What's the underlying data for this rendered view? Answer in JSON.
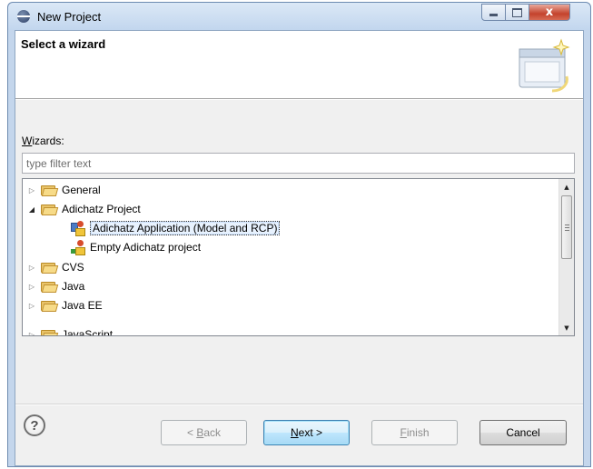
{
  "window": {
    "title": "New Project",
    "controls": {
      "minimize": "",
      "maximize": "",
      "close": "x"
    }
  },
  "header": {
    "title": "Select a wizard"
  },
  "wizards": {
    "label_first": "W",
    "label_rest": "izards:",
    "filter_placeholder": "type filter text",
    "filter_value": ""
  },
  "tree": {
    "items": [
      {
        "label": "General",
        "expanded": false,
        "icon": "folder-icon"
      },
      {
        "label": "Adichatz Project",
        "expanded": true,
        "icon": "folder-icon"
      },
      {
        "label": "Adichatz Application (Model and RCP)",
        "icon": "adichatz-application-icon",
        "selected": true
      },
      {
        "label": "Empty Adichatz project",
        "icon": "adichatz-project-icon"
      },
      {
        "label": "CVS",
        "expanded": false,
        "icon": "folder-icon"
      },
      {
        "label": "Java",
        "expanded": false,
        "icon": "folder-icon"
      },
      {
        "label": "Java EE",
        "expanded": false,
        "icon": "folder-icon"
      },
      {
        "label": "JavaScript",
        "expanded": false,
        "icon": "folder-icon"
      }
    ]
  },
  "buttons": {
    "back_prefix": "< ",
    "back_accel": "B",
    "back_rest": "ack",
    "next_accel": "N",
    "next_rest": "ext >",
    "finish_accel": "F",
    "finish_rest": "inish",
    "cancel": "Cancel"
  },
  "icons": {
    "help": "?",
    "tree_collapsed": "▷",
    "tree_expanded": "◢",
    "scroll_up": "▲",
    "scroll_down": "▼"
  },
  "colors": {
    "window_border": "#6d8bb0",
    "close_button": "#c4432c",
    "default_button": "#3c7fb1",
    "selection": "#e8f2fe"
  }
}
